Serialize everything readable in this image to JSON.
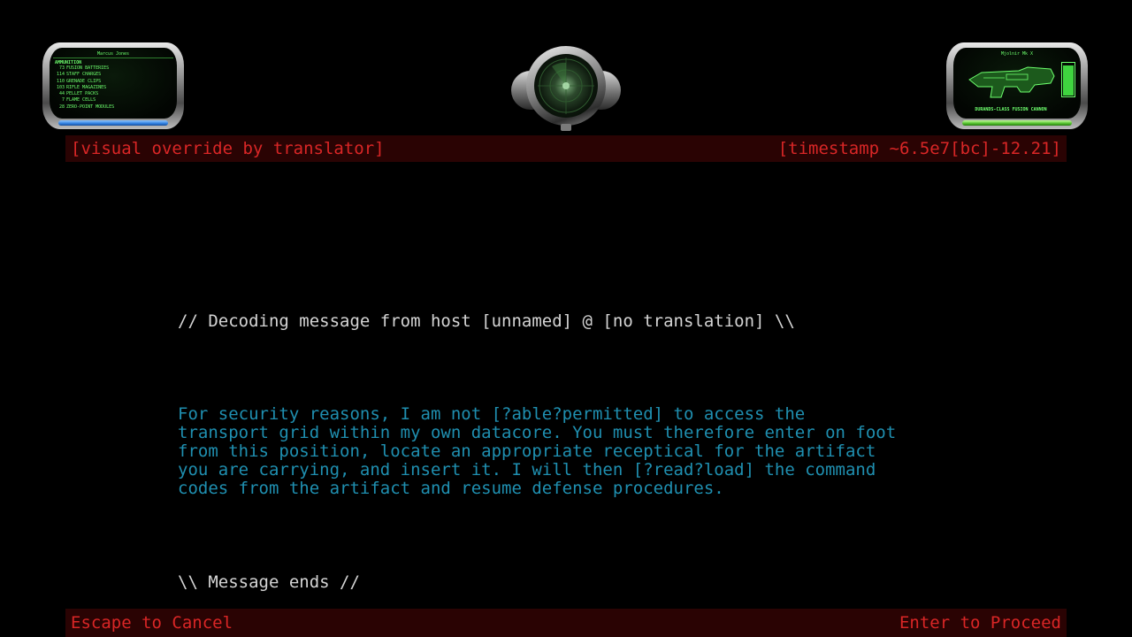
{
  "hud": {
    "ammo_panel": {
      "title": "Marcus Jones",
      "heading": "AMMUNITION",
      "items": [
        {
          "count": "73",
          "label": "FUSION BATTERIES"
        },
        {
          "count": "114",
          "label": "STAFF CHARGES"
        },
        {
          "count": "110",
          "label": "GRENADE CLIPS"
        },
        {
          "count": "103",
          "label": "RIFLE MAGAZINES"
        },
        {
          "count": "44",
          "label": "PELLET PACKS"
        },
        {
          "count": "7",
          "label": "FLAME CELLS"
        },
        {
          "count": "28",
          "label": "ZERO-POINT MODULES"
        }
      ],
      "shield_level": 1.0,
      "bar_color": "#2e7fe0"
    },
    "radar": {
      "icon": "motion-sensor-radar-icon"
    },
    "weapon_panel": {
      "name": "Mjolnir Mk X",
      "caption": "DURANDS-CLASS FUSION CANNON",
      "icon": "fusion-cannon-icon",
      "charge_level": 0.95,
      "bar_level": 1.0,
      "bar_color": "#4fbf2a"
    }
  },
  "top_banner": {
    "left": "[visual override by translator]",
    "right": "[timestamp ~6.5e7[bc]-12.21]"
  },
  "message": {
    "header": "// Decoding message from host [unnamed] @ [no translation] \\\\",
    "body": "For security reasons, I am not [?able?permitted] to access the\ntransport grid within my own datacore. You must therefore enter on foot\nfrom this position, locate an appropriate receptical for the artifact\nyou are carrying, and insert it. I will then [?read?load] the command\ncodes from the artifact and resume defense procedures.",
    "footer": "\\\\ Message ends //"
  },
  "bottom_banner": {
    "cancel": "Escape to Cancel",
    "proceed": "Enter to Proceed"
  },
  "colors": {
    "banner_bg": "#2a0303",
    "banner_text": "#d92626",
    "terminal_text": "#d4d4d4",
    "message_text": "#1f8fb0",
    "hud_green": "#6dff6d"
  }
}
